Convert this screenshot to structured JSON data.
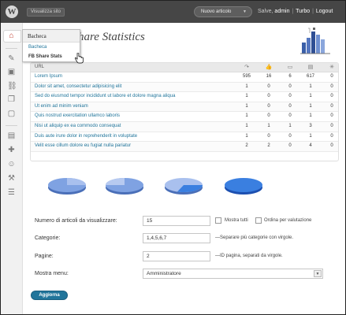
{
  "topbar": {
    "site_button": "Visualizza sito",
    "new_article": "Nuovo articolo",
    "greeting": "Salve,",
    "user": "admin",
    "separator": "|",
    "turbo": "Turbo",
    "logout": "Logout"
  },
  "flyout": {
    "header": "Bacheca",
    "items": [
      "Bacheca",
      "FB Share Stats"
    ]
  },
  "page": {
    "title_visible": "hare Statistics"
  },
  "table": {
    "url_header": "URL",
    "column_icons": [
      "share-icon",
      "like-icon",
      "comment-icon",
      "total-icon",
      "click-icon"
    ],
    "rows": [
      {
        "url": "Lorem Ipsum",
        "values": [
          "595",
          "16",
          "6",
          "617",
          "0"
        ]
      },
      {
        "url": "Dolor sit amet, consectetur adipisicing elit",
        "values": [
          "1",
          "0",
          "0",
          "1",
          "0"
        ]
      },
      {
        "url": "Sed do eiusmod tempor incididunt ut labore et dolore magna aliqua",
        "values": [
          "1",
          "0",
          "0",
          "1",
          "0"
        ]
      },
      {
        "url": "Ut enim ad minim veniam",
        "values": [
          "1",
          "0",
          "0",
          "1",
          "0"
        ]
      },
      {
        "url": "Quis nostrud exercitation ullamco laboris",
        "values": [
          "1",
          "0",
          "0",
          "1",
          "0"
        ]
      },
      {
        "url": "Nisi ut aliquip ex ea commodo consequat",
        "values": [
          "1",
          "1",
          "1",
          "3",
          "0"
        ]
      },
      {
        "url": "Duis aute irure dolor in reprehenderit in voluptate",
        "values": [
          "1",
          "0",
          "0",
          "1",
          "0"
        ]
      },
      {
        "url": "Velit esse cillum dolore eu fugiat nulla pariatur",
        "values": [
          "2",
          "2",
          "0",
          "4",
          "0"
        ]
      }
    ]
  },
  "form": {
    "num_label": "Numero di articoli da visualizzare:",
    "num_value": "15",
    "show_all": "Mostra tutti",
    "order_by": "Ordina per valutazione",
    "cat_label": "Categorie:",
    "cat_value": "1,4,5,6,7",
    "cat_note": "—Separare più categorie con virgole.",
    "pages_label": "Pagine:",
    "pages_value": "2",
    "pages_note": "—ID pagina, separati da virgole.",
    "menu_label": "Mostra menu:",
    "menu_value": "Amministratore",
    "submit": "Aggiorna"
  },
  "colors": {
    "topbar": "#464646",
    "link": "#21759b",
    "pie_blue": "#3a7fe0"
  }
}
